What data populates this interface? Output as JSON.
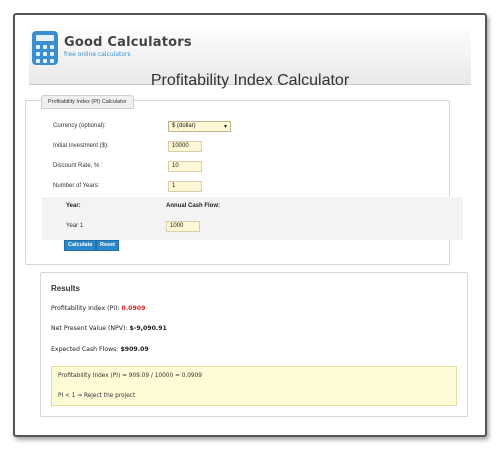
{
  "brand": {
    "name": "Good Calculators",
    "tagline": "free online calculators",
    "accent_color": "#3b8fd1"
  },
  "page_title": "Profitability Index Calculator",
  "calculator": {
    "tab_label": "Profitability Index (PI) Calculator",
    "fields": {
      "currency": {
        "label": "Currency (optional):",
        "value": "$ (dollar)"
      },
      "initial_investment": {
        "label": "Initial Investment ($):",
        "value": "10000"
      },
      "discount_rate": {
        "label": "Discount Rate, % :",
        "value": "10"
      },
      "num_years": {
        "label": "Number of Years:",
        "value": "1"
      }
    },
    "cashflow": {
      "year_header": "Year:",
      "cash_header": "Annual Cash Flow:",
      "rows": [
        {
          "year": "Year 1",
          "value": "1000"
        }
      ]
    },
    "buttons": {
      "calculate": "Calculate",
      "reset": "Reset"
    }
  },
  "results": {
    "title": "Results",
    "pi": {
      "label": "Profitability Index (PI):",
      "value": "0.0909",
      "color": "#e02020"
    },
    "npv": {
      "label": "Net Present Value (NPV):",
      "value": "$-9,090.91"
    },
    "ecf": {
      "label": "Expected Cash Flows:",
      "value": "$909.09"
    },
    "explanation": {
      "formula": "Profitability Index (PI) = 909.09 / 10000 = 0.0909",
      "verdict": "PI < 1 ⇒ Reject the project"
    }
  }
}
